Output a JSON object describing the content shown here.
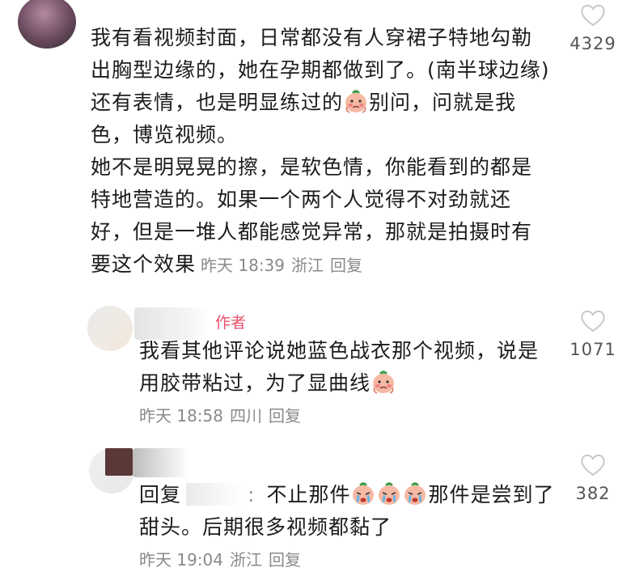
{
  "comments": [
    {
      "lines": [
        "我有看视频封面，日常都没有人穿裙子特地勾勒",
        "出胸型边缘的，她在孕期都做到了。(南半球边缘)",
        "还有表情，也是明显练过的",
        "别问，问就是我",
        "色，博览视频。",
        "她不是明晃晃的擦，是软色情，你能看到的都是",
        "特地营造的。如果一个两个人觉得不对劲就还",
        "好，但是一堆人都能感觉异常，那就是拍摄时有",
        "要这个效果"
      ],
      "time": "昨天 18:39",
      "location": "浙江",
      "reply_label": "回复",
      "likes": "4329"
    },
    {
      "author_tag": "作者",
      "lines": [
        "我看其他评论说她蓝色战衣那个视频，说是",
        "用胶带粘过，为了显曲线"
      ],
      "time": "昨天 18:58",
      "location": "四川",
      "reply_label": "回复",
      "likes": "1071"
    },
    {
      "reply_prefix": "回复",
      "colon": ":",
      "lines": [
        "不止那件",
        "那件是尝到了",
        "甜头。后期很多视频都黏了"
      ],
      "time": "昨天 19:04",
      "location": "浙江",
      "reply_label": "回复",
      "likes": "382"
    }
  ],
  "icons": {
    "like": "heart-outline-icon",
    "emoji_blush": "embarrassed-face-emoji",
    "emoji_cry": "crying-face-emoji"
  },
  "colors": {
    "meta": "#8a8a8a",
    "author_tag": "#e8506a"
  }
}
